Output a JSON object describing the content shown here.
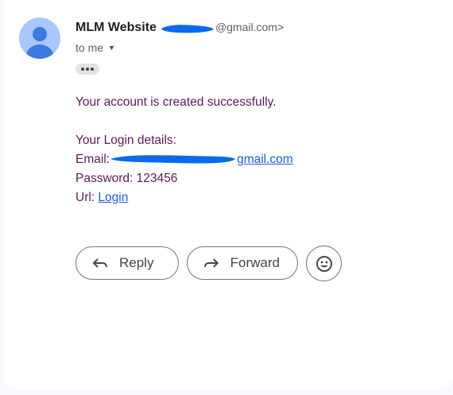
{
  "sender": {
    "name": "MLM Website",
    "email_visible": "@gmail.com>",
    "to_label": "to me"
  },
  "message": {
    "line1": "Your account is created successfully.",
    "details_heading": "Your Login details:",
    "email_label": "Email:",
    "email_value_visible": "gmail.com",
    "password_line": "Password: 123456",
    "url_label": "Url:",
    "url_link_text": "Login"
  },
  "actions": {
    "reply_label": "Reply",
    "forward_label": "Forward"
  },
  "icons": {
    "avatar": "avatar-person-icon",
    "caret": "chevron-down-icon",
    "more": "more-horizontal-icon",
    "reply": "reply-icon",
    "forward": "forward-icon",
    "emoji": "emoji-icon"
  },
  "colors": {
    "message_text": "#5b1a5b",
    "link": "#1a5dd4",
    "redaction": "#0a6bea",
    "avatar_bg": "#a8c7fa",
    "avatar_fg": "#3b7ae0"
  }
}
